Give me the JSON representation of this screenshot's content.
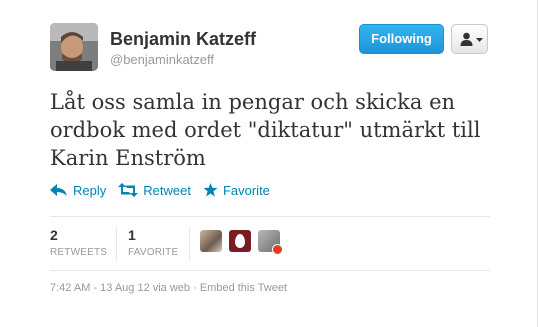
{
  "user": {
    "name": "Benjamin Katzeff",
    "handle": "@benjaminkatzeff"
  },
  "buttons": {
    "follow_label": "Following"
  },
  "tweet": {
    "text": "Låt oss samla in pengar och skicka en ordbok med ordet \"diktatur\" utmärkt till Karin Enström"
  },
  "actions": {
    "reply": "Reply",
    "retweet": "Retweet",
    "favorite": "Favorite"
  },
  "stats": {
    "retweets_count": "2",
    "retweets_label": "RETWEETS",
    "favorites_count": "1",
    "favorites_label": "FAVORITE"
  },
  "footer": {
    "timestamp": "7:42 AM - 13 Aug 12 via web",
    "separator": "·",
    "embed": "Embed this Tweet"
  },
  "colors": {
    "link": "#0084b4",
    "follow_button": "#2ba6e8",
    "text": "#333333",
    "muted": "#999999"
  },
  "icons": [
    "reply-icon",
    "retweet-icon",
    "star-icon",
    "person-icon",
    "caret-down-icon",
    "egg-icon"
  ]
}
